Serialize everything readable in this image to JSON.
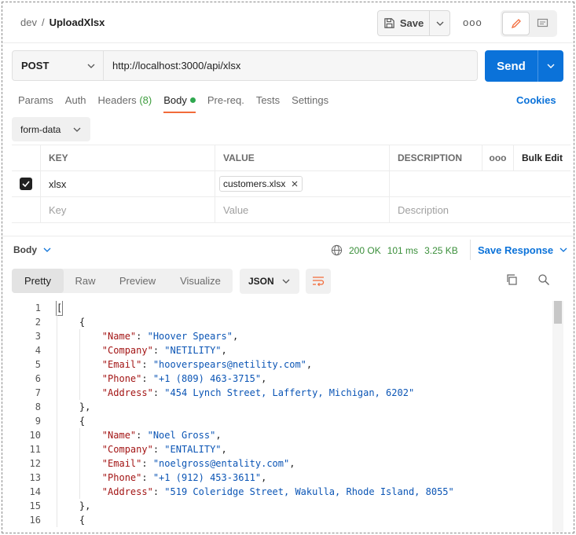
{
  "breadcrumb": {
    "env": "dev",
    "sep": "/",
    "name": "UploadXlsx"
  },
  "header": {
    "save_label": "Save",
    "more_label": "ooo"
  },
  "request": {
    "method": "POST",
    "url": "http://localhost:3000/api/xlsx",
    "send_label": "Send"
  },
  "tabs": {
    "params": "Params",
    "auth": "Auth",
    "headers": "Headers",
    "headers_count": "(8)",
    "body": "Body",
    "prereq": "Pre-req.",
    "tests": "Tests",
    "settings": "Settings",
    "cookies": "Cookies"
  },
  "body_type": "form-data",
  "params_table": {
    "headers": {
      "key": "KEY",
      "value": "VALUE",
      "description": "DESCRIPTION",
      "more": "ooo",
      "bulk_edit": "Bulk Edit"
    },
    "rows": [
      {
        "key": "xlsx",
        "file": "customers.xlsx",
        "checked": true
      }
    ],
    "placeholder": {
      "key": "Key",
      "value": "Value",
      "description": "Description"
    }
  },
  "response": {
    "label": "Body",
    "status": "200 OK",
    "time": "101 ms",
    "size": "3.25 KB",
    "save_response": "Save Response",
    "views": [
      "Pretty",
      "Raw",
      "Preview",
      "Visualize"
    ],
    "active_view": "Pretty",
    "format": "JSON"
  },
  "code_lines": [
    {
      "n": "1",
      "indent": 0,
      "parts": [
        [
          "p",
          "["
        ]
      ]
    },
    {
      "n": "2",
      "indent": 1,
      "parts": [
        [
          "p",
          "{"
        ]
      ]
    },
    {
      "n": "3",
      "indent": 2,
      "parts": [
        [
          "k",
          "\"Name\""
        ],
        [
          "p",
          ": "
        ],
        [
          "s",
          "\"Hoover Spears\""
        ],
        [
          "p",
          ","
        ]
      ]
    },
    {
      "n": "4",
      "indent": 2,
      "parts": [
        [
          "k",
          "\"Company\""
        ],
        [
          "p",
          ": "
        ],
        [
          "s",
          "\"NETILITY\""
        ],
        [
          "p",
          ","
        ]
      ]
    },
    {
      "n": "5",
      "indent": 2,
      "parts": [
        [
          "k",
          "\"Email\""
        ],
        [
          "p",
          ": "
        ],
        [
          "s",
          "\"hooverspears@netility.com\""
        ],
        [
          "p",
          ","
        ]
      ]
    },
    {
      "n": "6",
      "indent": 2,
      "parts": [
        [
          "k",
          "\"Phone\""
        ],
        [
          "p",
          ": "
        ],
        [
          "s",
          "\"+1 (809) 463-3715\""
        ],
        [
          "p",
          ","
        ]
      ]
    },
    {
      "n": "7",
      "indent": 2,
      "parts": [
        [
          "k",
          "\"Address\""
        ],
        [
          "p",
          ": "
        ],
        [
          "s",
          "\"454 Lynch Street, Lafferty, Michigan, 6202\""
        ]
      ]
    },
    {
      "n": "8",
      "indent": 1,
      "parts": [
        [
          "p",
          "},"
        ]
      ]
    },
    {
      "n": "9",
      "indent": 1,
      "parts": [
        [
          "p",
          "{"
        ]
      ]
    },
    {
      "n": "10",
      "indent": 2,
      "parts": [
        [
          "k",
          "\"Name\""
        ],
        [
          "p",
          ": "
        ],
        [
          "s",
          "\"Noel Gross\""
        ],
        [
          "p",
          ","
        ]
      ]
    },
    {
      "n": "11",
      "indent": 2,
      "parts": [
        [
          "k",
          "\"Company\""
        ],
        [
          "p",
          ": "
        ],
        [
          "s",
          "\"ENTALITY\""
        ],
        [
          "p",
          ","
        ]
      ]
    },
    {
      "n": "12",
      "indent": 2,
      "parts": [
        [
          "k",
          "\"Email\""
        ],
        [
          "p",
          ": "
        ],
        [
          "s",
          "\"noelgross@entality.com\""
        ],
        [
          "p",
          ","
        ]
      ]
    },
    {
      "n": "13",
      "indent": 2,
      "parts": [
        [
          "k",
          "\"Phone\""
        ],
        [
          "p",
          ": "
        ],
        [
          "s",
          "\"+1 (912) 453-3611\""
        ],
        [
          "p",
          ","
        ]
      ]
    },
    {
      "n": "14",
      "indent": 2,
      "parts": [
        [
          "k",
          "\"Address\""
        ],
        [
          "p",
          ": "
        ],
        [
          "s",
          "\"519 Coleridge Street, Wakulla, Rhode Island, 8055\""
        ]
      ]
    },
    {
      "n": "15",
      "indent": 1,
      "parts": [
        [
          "p",
          "},"
        ]
      ]
    },
    {
      "n": "16",
      "indent": 1,
      "parts": [
        [
          "p",
          "{"
        ]
      ]
    }
  ],
  "colors": {
    "accent": "#0b72d9",
    "tab_underline": "#f26b3a",
    "json_key": "#a31515",
    "json_string": "#0b55b5",
    "status_ok": "#3a8f3a"
  }
}
